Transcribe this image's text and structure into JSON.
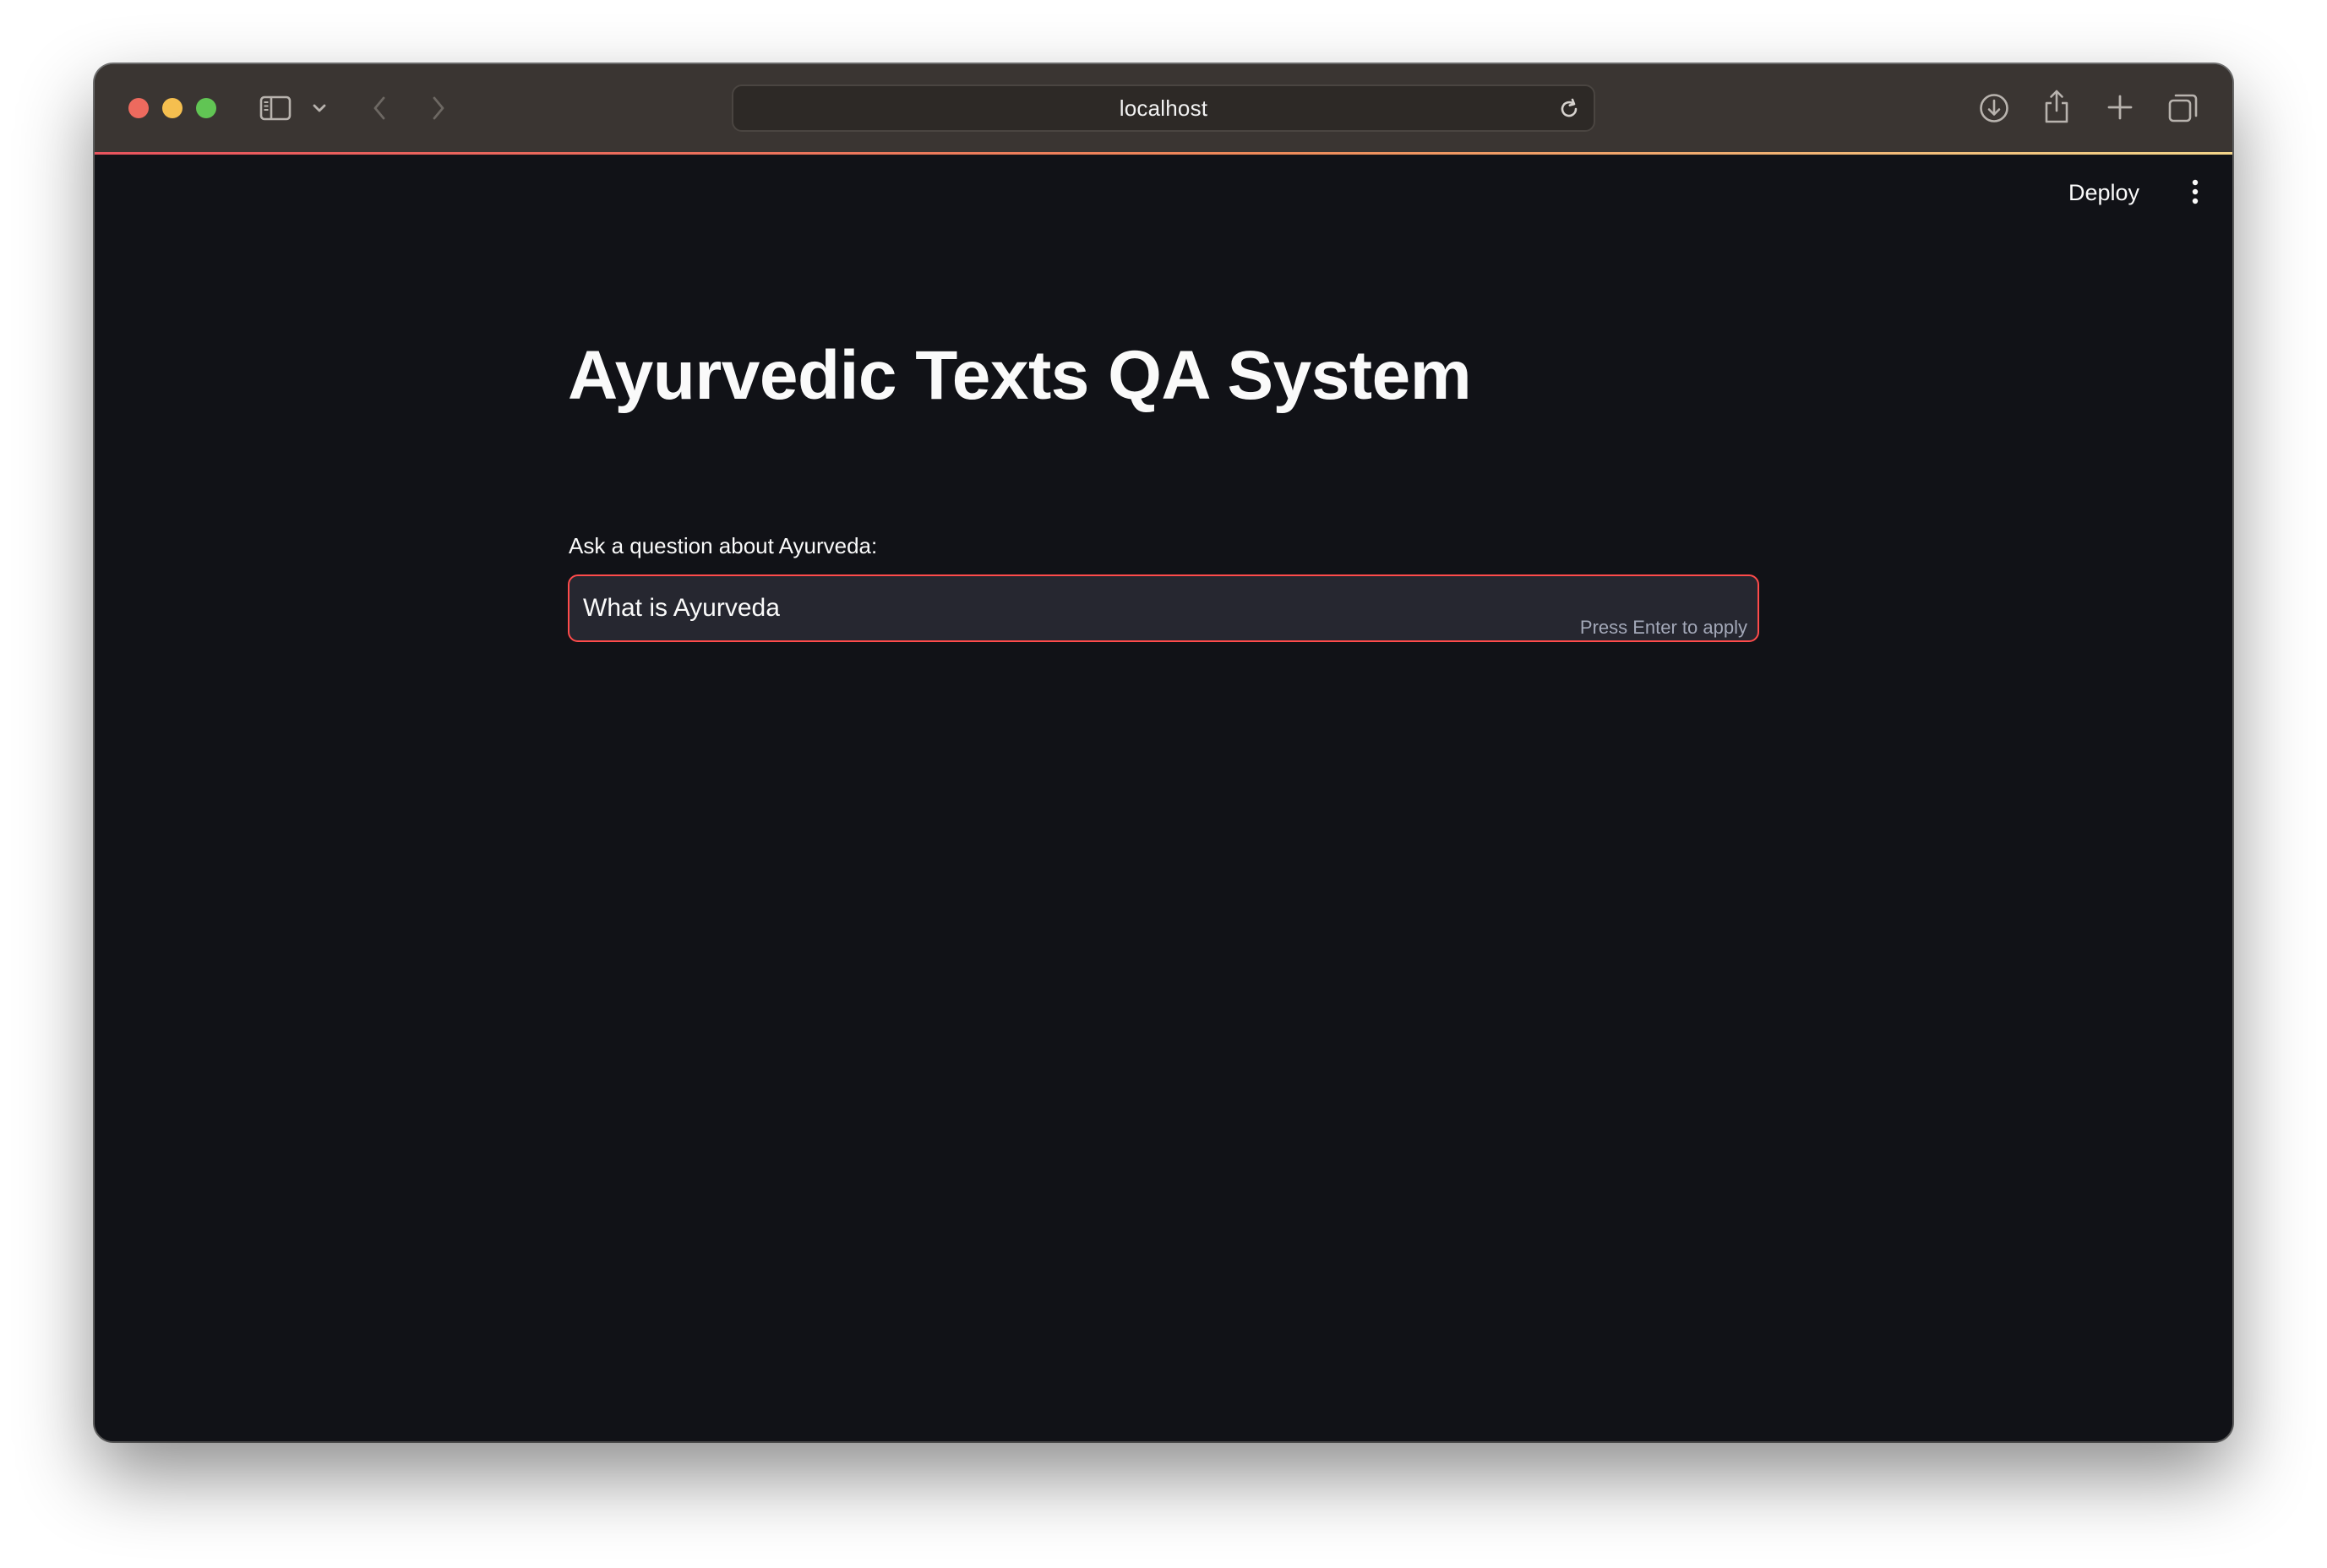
{
  "browser": {
    "url": "localhost",
    "icons": {
      "close": "close-button",
      "minimize": "minimize-button",
      "maximize": "maximize-button",
      "sidebar": "sidebar-icon",
      "tab_groups": "chevron-down-icon",
      "back": "back-arrow-icon",
      "forward": "forward-arrow-icon",
      "reload": "reload-icon",
      "downloads": "download-icon",
      "share": "share-icon",
      "new_tab": "plus-icon",
      "tab_overview": "tabs-icon"
    }
  },
  "app": {
    "deploy_label": "Deploy",
    "menu_icon": "kebab-menu-icon",
    "title": "Ayurvedic Texts QA System",
    "question_label": "Ask a question about Ayurveda:",
    "question_value": "What is Ayurveda",
    "input_hint": "Press Enter to apply"
  },
  "colors": {
    "background": "#111217",
    "titlebar": "#3a3532",
    "accent": "#ff4b4b",
    "input_bg": "#262730",
    "text": "#fafafa"
  }
}
